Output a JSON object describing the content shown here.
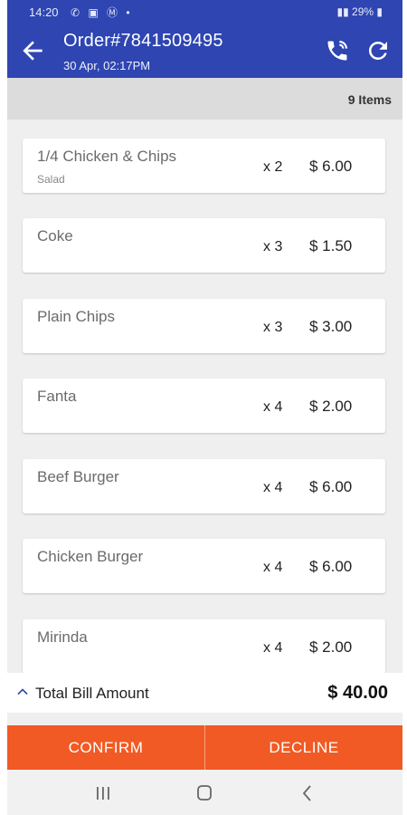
{
  "status_bar": {
    "time": "14:20",
    "left_icons": "✆ ▣ Ⓜ •",
    "right_text": "29%"
  },
  "header": {
    "title": "Order#7841509495",
    "date": "30 Apr, 02:17PM"
  },
  "items_count": "9 Items",
  "items": [
    {
      "name": "1/4 Chicken & Chips",
      "note": "Salad",
      "qty": "x 2",
      "price": "$ 6.00"
    },
    {
      "name": "Coke",
      "note": "",
      "qty": "x 3",
      "price": "$ 1.50"
    },
    {
      "name": "Plain Chips",
      "note": "",
      "qty": "x 3",
      "price": "$ 3.00"
    },
    {
      "name": "Fanta",
      "note": "",
      "qty": "x 4",
      "price": "$ 2.00"
    },
    {
      "name": "Beef Burger",
      "note": "",
      "qty": "x 4",
      "price": "$ 6.00"
    },
    {
      "name": "Chicken Burger",
      "note": "",
      "qty": "x 4",
      "price": "$ 6.00"
    },
    {
      "name": "Mirinda",
      "note": "",
      "qty": "x 4",
      "price": "$ 2.00"
    }
  ],
  "total": {
    "label": "Total Bill Amount",
    "amount": "$ 40.00"
  },
  "actions": {
    "confirm": "CONFIRM",
    "decline": "DECLINE"
  },
  "colors": {
    "header_blue": "#2e45b2",
    "action_orange": "#f15a24"
  },
  "icons": [
    "back-arrow-icon",
    "phone-call-icon",
    "refresh-icon",
    "chevron-up-icon",
    "recents-icon",
    "home-icon",
    "back-icon"
  ]
}
